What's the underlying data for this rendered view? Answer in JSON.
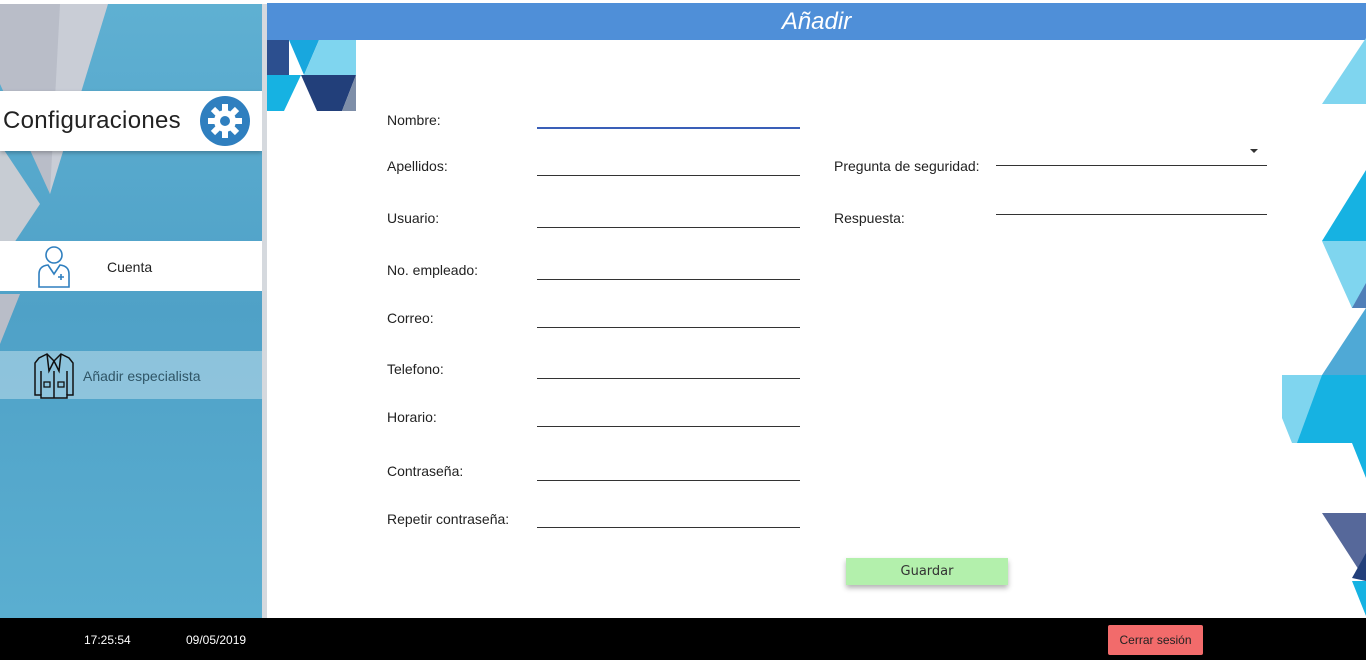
{
  "sidebar": {
    "title": "Configuraciones",
    "items": [
      {
        "label": "Cuenta",
        "icon": "doctor-user-icon"
      },
      {
        "label": "Añadir especialista",
        "icon": "doctor-coat-icon"
      }
    ],
    "gear_icon": "gear-icon"
  },
  "header": {
    "title": "Añadir"
  },
  "form": {
    "left": [
      {
        "label": "Nombre:",
        "value": ""
      },
      {
        "label": "Apellidos:",
        "value": ""
      },
      {
        "label": "Usuario:",
        "value": ""
      },
      {
        "label": "No. empleado:",
        "value": ""
      },
      {
        "label": "Correo:",
        "value": ""
      },
      {
        "label": "Telefono:",
        "value": ""
      },
      {
        "label": "Horario:",
        "value": ""
      },
      {
        "label": "Contraseña:",
        "value": ""
      },
      {
        "label": "Repetir contraseña:",
        "value": ""
      }
    ],
    "right": [
      {
        "label": "Pregunta de seguridad:",
        "value": ""
      },
      {
        "label": "Respuesta:",
        "value": ""
      }
    ],
    "save_label": "Guardar"
  },
  "status": {
    "time": "17:25:54",
    "date": "09/05/2019",
    "logout_label": "Cerrar sesión"
  },
  "colors": {
    "header": "#4f8fd8",
    "save_button": "#b3f0ac",
    "logout_button": "#f26b6b",
    "sidebar": "#5aaed0"
  }
}
